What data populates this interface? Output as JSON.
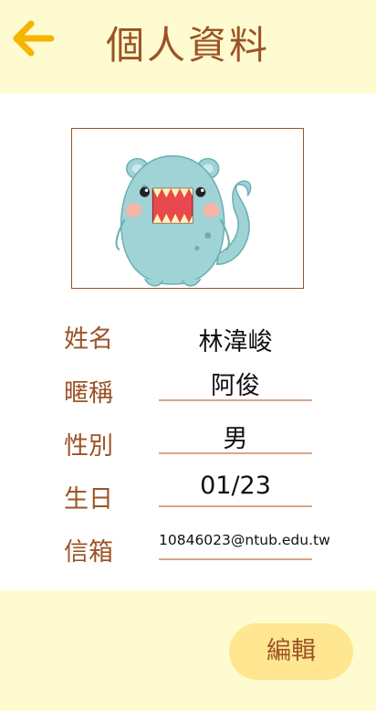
{
  "header": {
    "title": "個人資料",
    "back_icon": "arrow-left-icon",
    "accent_color": "#f5b400"
  },
  "avatar": {
    "icon": "monster-avatar-illustration"
  },
  "profile": {
    "name_label": "姓名",
    "name_value": "林湋峻",
    "nickname_label": "暱稱",
    "nickname_value": "阿俊",
    "gender_label": "性別",
    "gender_value": "男",
    "birthday_label": "生日",
    "birthday_value": "01/23",
    "email_label": "信箱",
    "email_value": "10846023@ntub.edu.tw"
  },
  "footer": {
    "edit_label": "編輯"
  },
  "colors": {
    "brand_brown": "#9c5326",
    "background_cream": "#fffbd0",
    "button_yellow": "#ffe690",
    "underline": "#d6a78c"
  }
}
